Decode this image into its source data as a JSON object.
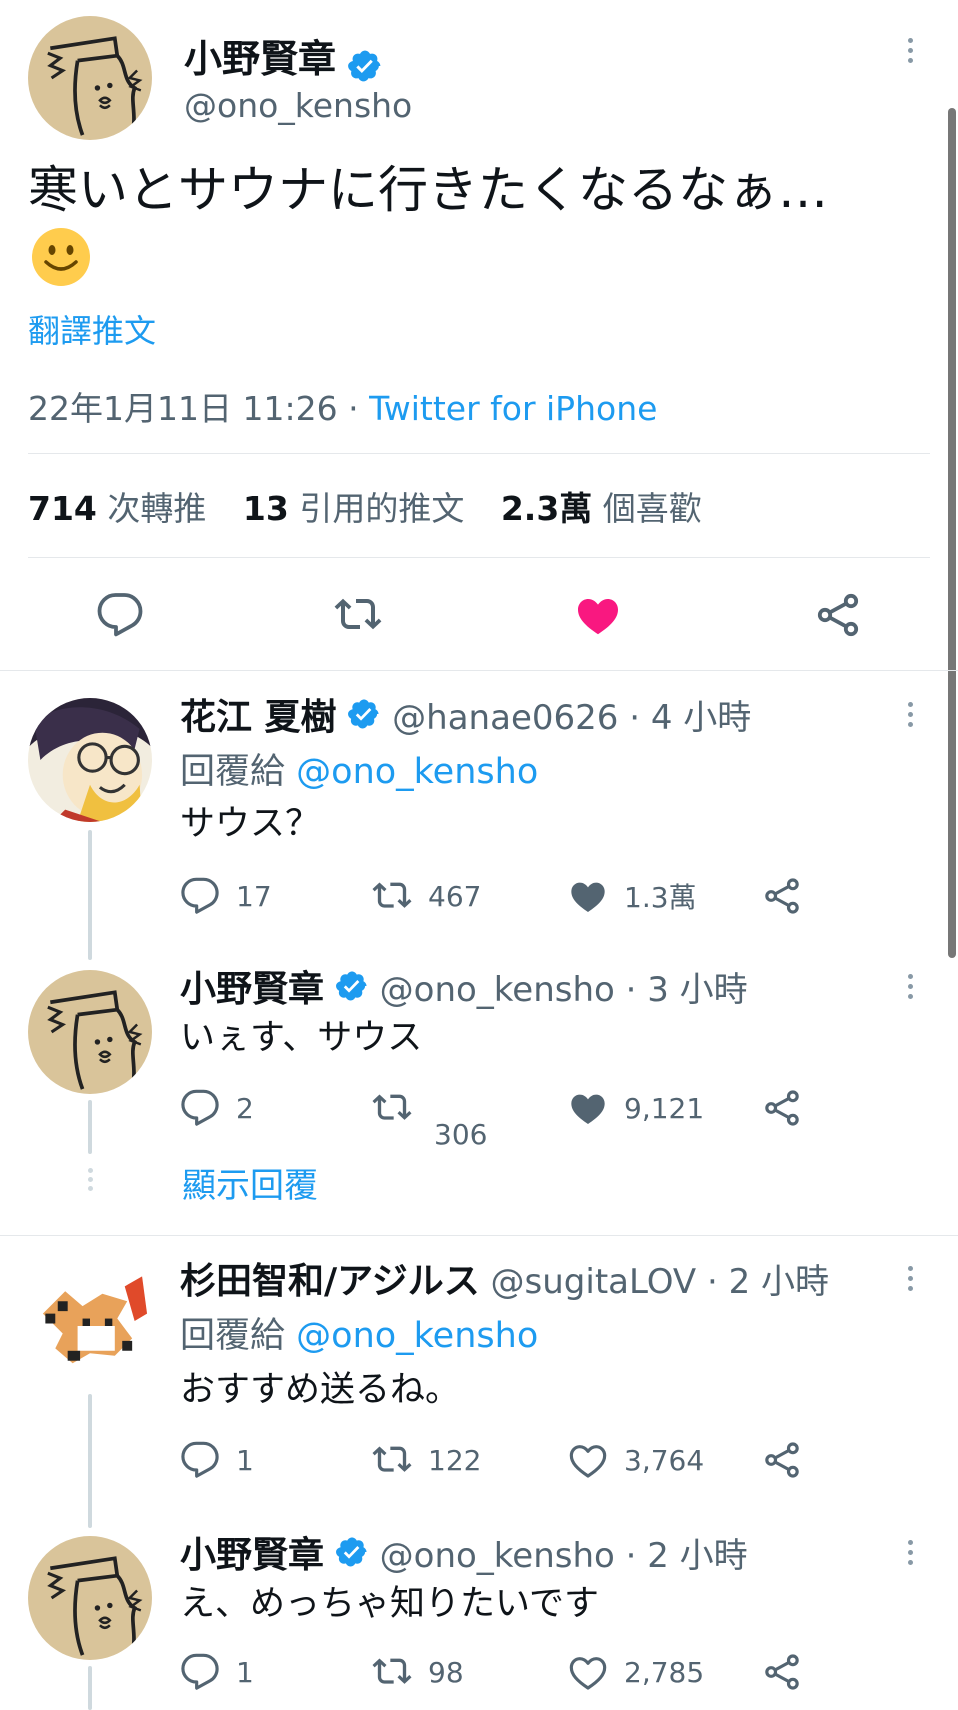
{
  "main_tweet": {
    "author_name": "小野賢章",
    "handle": "@ono_kensho",
    "text": "寒いとサウナに行きたくなるなぁ…",
    "emoji": "🙂",
    "translate_label": "翻譯推文",
    "timestamp": "22年1月11日 11:26",
    "separator": " · ",
    "source": "Twitter for iPhone",
    "stats": {
      "retweets_count": "714",
      "retweets_label": "次轉推",
      "quotes_count": "13",
      "quotes_label": "引用的推文",
      "likes_count": "2.3萬",
      "likes_label": "個喜歡"
    }
  },
  "replies": [
    {
      "author_name": "花江 夏樹",
      "handle": "@hanae0626",
      "time": " · 4 小時",
      "reply_to_label": "回覆給",
      "reply_to_handle": "@ono_kensho",
      "text": "サウス？",
      "reply_count": "17",
      "retweet_count": "467",
      "like_count": "1.3萬",
      "liked": true
    },
    {
      "author_name": "小野賢章",
      "handle": "@ono_kensho",
      "time": " · 3 小時",
      "text": "いぇす、サウス",
      "reply_count": "2",
      "retweet_count": "306",
      "like_count": "9,121",
      "liked": true,
      "show_replies_label": "顯示回覆"
    },
    {
      "author_name": "杉田智和/アジルス",
      "handle": "@sugitaLOV",
      "time": " · 2 小時",
      "reply_to_label": "回覆給",
      "reply_to_handle": "@ono_kensho",
      "text": "おすすめ送るね。",
      "reply_count": "1",
      "retweet_count": "122",
      "like_count": "3,764",
      "liked": false
    },
    {
      "author_name": "小野賢章",
      "handle": "@ono_kensho",
      "time": " · 2 小時",
      "text": "え、めっちゃ知りたいです",
      "reply_count": "1",
      "retweet_count": "98",
      "like_count": "2,785",
      "liked": false
    }
  ],
  "colors": {
    "accent": "#1d9bf0",
    "like": "#f91880",
    "muted": "#536471"
  }
}
